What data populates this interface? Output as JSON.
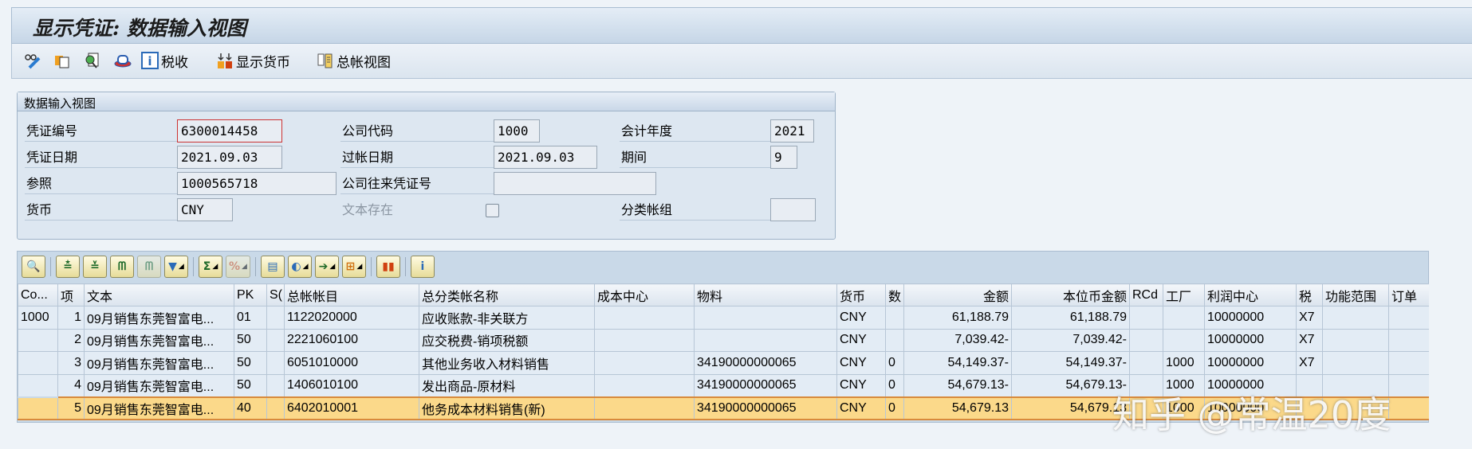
{
  "title": "显示凭证: 数据输入视图",
  "toolbar": {
    "tax_label": "税收",
    "currency_label": "显示货币",
    "gl_view_label": "总帐视图"
  },
  "panel": {
    "title": "数据输入视图",
    "doc_no_label": "凭证编号",
    "doc_no": "6300014458",
    "company_label": "公司代码",
    "company": "1000",
    "fiscal_year_label": "会计年度",
    "fiscal_year": "2021",
    "doc_date_label": "凭证日期",
    "doc_date": "2021.09.03",
    "posting_date_label": "过帐日期",
    "posting_date": "2021.09.03",
    "period_label": "期间",
    "period": "9",
    "reference_label": "参照",
    "reference": "1000565718",
    "intercompany_label": "公司往来凭证号",
    "intercompany": "",
    "currency_label": "货币",
    "currency": "CNY",
    "text_exists_label": "文本存在",
    "ledger_group_label": "分类帐组",
    "ledger_group": ""
  },
  "table": {
    "columns": [
      "Co...",
      "项",
      "文本",
      "PK",
      "S(",
      "总帐帐目",
      "总分类帐名称",
      "成本中心",
      "物料",
      "货币",
      "数",
      "金额",
      "本位币金额",
      "RCd",
      "工厂",
      "利润中心",
      "税",
      "功能范围",
      "订单"
    ],
    "rows": [
      [
        "1000",
        "1",
        "09月销售东莞智富电...",
        "01",
        "",
        "1122020000",
        "应收账款-非关联方",
        "",
        "",
        "CNY",
        "",
        "61,188.79",
        "61,188.79",
        "",
        "",
        "10000000",
        "X7",
        "",
        ""
      ],
      [
        "",
        "2",
        "09月销售东莞智富电...",
        "50",
        "",
        "2221060100",
        "应交税费-销项税额",
        "",
        "",
        "CNY",
        "",
        "7,039.42-",
        "7,039.42-",
        "",
        "",
        "10000000",
        "X7",
        "",
        ""
      ],
      [
        "",
        "3",
        "09月销售东莞智富电...",
        "50",
        "",
        "6051010000",
        "其他业务收入材料销售",
        "",
        "34190000000065",
        "CNY",
        "0",
        "54,149.37-",
        "54,149.37-",
        "",
        "1000",
        "10000000",
        "X7",
        "",
        ""
      ],
      [
        "",
        "4",
        "09月销售东莞智富电...",
        "50",
        "",
        "1406010100",
        "发出商品-原材料",
        "",
        "34190000000065",
        "CNY",
        "0",
        "54,679.13-",
        "54,679.13-",
        "",
        "1000",
        "10000000",
        "",
        "",
        ""
      ],
      [
        "",
        "5",
        "09月销售东莞智富电...",
        "40",
        "",
        "6402010001",
        "他务成本材料销售(新)",
        "",
        "34190000000065",
        "CNY",
        "0",
        "54,679.13",
        "54,679.13",
        "",
        "1000",
        "10000000",
        "",
        "",
        ""
      ]
    ],
    "selected_row": 4
  },
  "watermark": "知乎 @常温20度"
}
